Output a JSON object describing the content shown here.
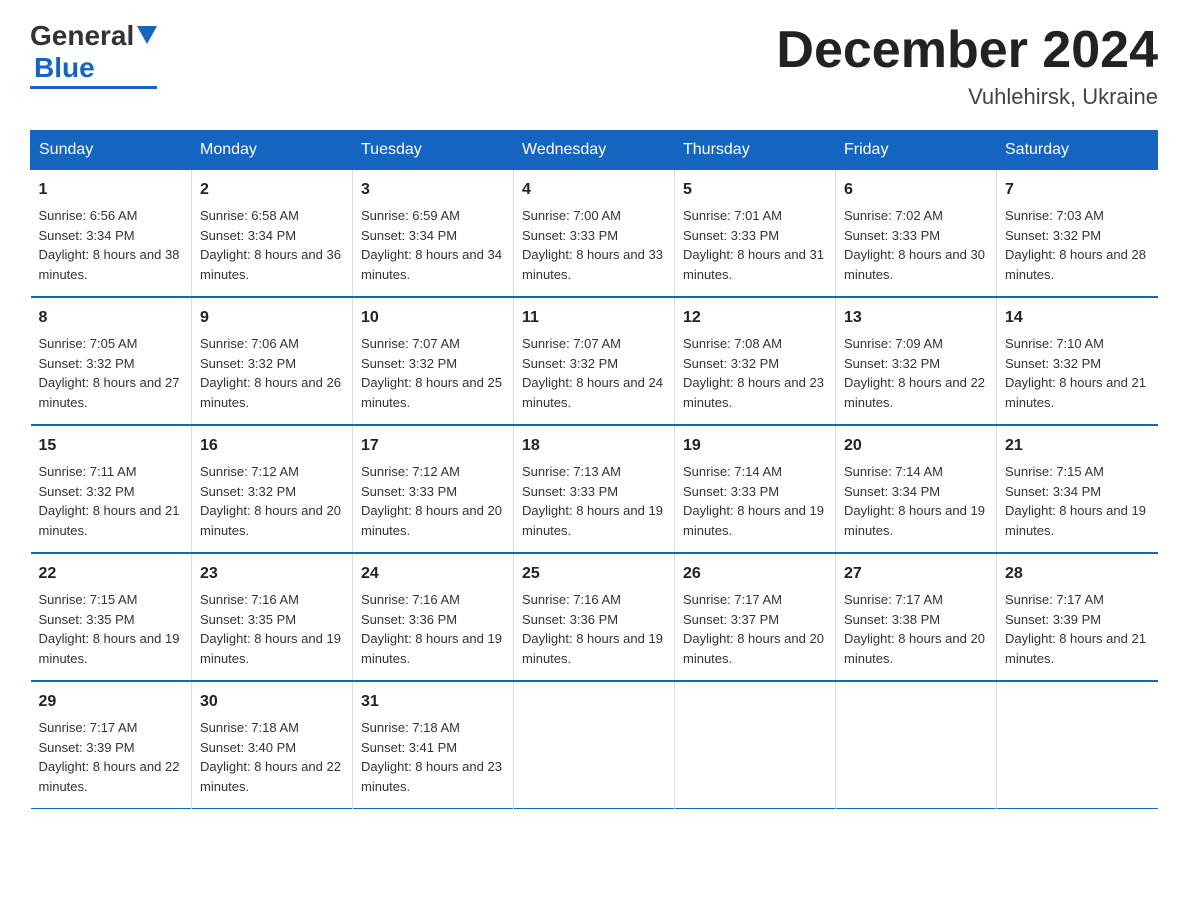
{
  "header": {
    "logo_general": "General",
    "logo_blue": "Blue",
    "month_title": "December 2024",
    "location": "Vuhlehirsk, Ukraine"
  },
  "weekdays": [
    "Sunday",
    "Monday",
    "Tuesday",
    "Wednesday",
    "Thursday",
    "Friday",
    "Saturday"
  ],
  "weeks": [
    [
      {
        "day": "1",
        "sunrise": "6:56 AM",
        "sunset": "3:34 PM",
        "daylight": "8 hours and 38 minutes."
      },
      {
        "day": "2",
        "sunrise": "6:58 AM",
        "sunset": "3:34 PM",
        "daylight": "8 hours and 36 minutes."
      },
      {
        "day": "3",
        "sunrise": "6:59 AM",
        "sunset": "3:34 PM",
        "daylight": "8 hours and 34 minutes."
      },
      {
        "day": "4",
        "sunrise": "7:00 AM",
        "sunset": "3:33 PM",
        "daylight": "8 hours and 33 minutes."
      },
      {
        "day": "5",
        "sunrise": "7:01 AM",
        "sunset": "3:33 PM",
        "daylight": "8 hours and 31 minutes."
      },
      {
        "day": "6",
        "sunrise": "7:02 AM",
        "sunset": "3:33 PM",
        "daylight": "8 hours and 30 minutes."
      },
      {
        "day": "7",
        "sunrise": "7:03 AM",
        "sunset": "3:32 PM",
        "daylight": "8 hours and 28 minutes."
      }
    ],
    [
      {
        "day": "8",
        "sunrise": "7:05 AM",
        "sunset": "3:32 PM",
        "daylight": "8 hours and 27 minutes."
      },
      {
        "day": "9",
        "sunrise": "7:06 AM",
        "sunset": "3:32 PM",
        "daylight": "8 hours and 26 minutes."
      },
      {
        "day": "10",
        "sunrise": "7:07 AM",
        "sunset": "3:32 PM",
        "daylight": "8 hours and 25 minutes."
      },
      {
        "day": "11",
        "sunrise": "7:07 AM",
        "sunset": "3:32 PM",
        "daylight": "8 hours and 24 minutes."
      },
      {
        "day": "12",
        "sunrise": "7:08 AM",
        "sunset": "3:32 PM",
        "daylight": "8 hours and 23 minutes."
      },
      {
        "day": "13",
        "sunrise": "7:09 AM",
        "sunset": "3:32 PM",
        "daylight": "8 hours and 22 minutes."
      },
      {
        "day": "14",
        "sunrise": "7:10 AM",
        "sunset": "3:32 PM",
        "daylight": "8 hours and 21 minutes."
      }
    ],
    [
      {
        "day": "15",
        "sunrise": "7:11 AM",
        "sunset": "3:32 PM",
        "daylight": "8 hours and 21 minutes."
      },
      {
        "day": "16",
        "sunrise": "7:12 AM",
        "sunset": "3:32 PM",
        "daylight": "8 hours and 20 minutes."
      },
      {
        "day": "17",
        "sunrise": "7:12 AM",
        "sunset": "3:33 PM",
        "daylight": "8 hours and 20 minutes."
      },
      {
        "day": "18",
        "sunrise": "7:13 AM",
        "sunset": "3:33 PM",
        "daylight": "8 hours and 19 minutes."
      },
      {
        "day": "19",
        "sunrise": "7:14 AM",
        "sunset": "3:33 PM",
        "daylight": "8 hours and 19 minutes."
      },
      {
        "day": "20",
        "sunrise": "7:14 AM",
        "sunset": "3:34 PM",
        "daylight": "8 hours and 19 minutes."
      },
      {
        "day": "21",
        "sunrise": "7:15 AM",
        "sunset": "3:34 PM",
        "daylight": "8 hours and 19 minutes."
      }
    ],
    [
      {
        "day": "22",
        "sunrise": "7:15 AM",
        "sunset": "3:35 PM",
        "daylight": "8 hours and 19 minutes."
      },
      {
        "day": "23",
        "sunrise": "7:16 AM",
        "sunset": "3:35 PM",
        "daylight": "8 hours and 19 minutes."
      },
      {
        "day": "24",
        "sunrise": "7:16 AM",
        "sunset": "3:36 PM",
        "daylight": "8 hours and 19 minutes."
      },
      {
        "day": "25",
        "sunrise": "7:16 AM",
        "sunset": "3:36 PM",
        "daylight": "8 hours and 19 minutes."
      },
      {
        "day": "26",
        "sunrise": "7:17 AM",
        "sunset": "3:37 PM",
        "daylight": "8 hours and 20 minutes."
      },
      {
        "day": "27",
        "sunrise": "7:17 AM",
        "sunset": "3:38 PM",
        "daylight": "8 hours and 20 minutes."
      },
      {
        "day": "28",
        "sunrise": "7:17 AM",
        "sunset": "3:39 PM",
        "daylight": "8 hours and 21 minutes."
      }
    ],
    [
      {
        "day": "29",
        "sunrise": "7:17 AM",
        "sunset": "3:39 PM",
        "daylight": "8 hours and 22 minutes."
      },
      {
        "day": "30",
        "sunrise": "7:18 AM",
        "sunset": "3:40 PM",
        "daylight": "8 hours and 22 minutes."
      },
      {
        "day": "31",
        "sunrise": "7:18 AM",
        "sunset": "3:41 PM",
        "daylight": "8 hours and 23 minutes."
      },
      null,
      null,
      null,
      null
    ]
  ]
}
